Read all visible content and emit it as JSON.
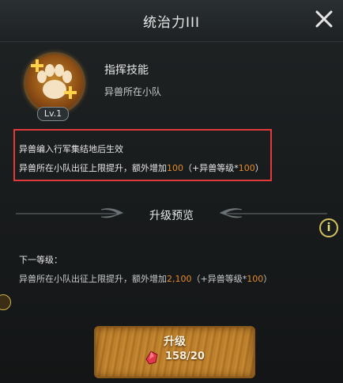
{
  "dialog": {
    "title": "统治力III"
  },
  "skill": {
    "icon": "beast-paw-skill-icon",
    "level": "Lv.1",
    "type": "指挥技能",
    "target": "异兽所在小队"
  },
  "description": {
    "line1": "异兽编入行军集结地后生效",
    "line2_prefix": "异兽所在小队出征上限提升，额外增加",
    "line2_value": "100",
    "line2_mid": "（+异兽等级*",
    "line2_value2": "100",
    "line2_suffix": "）"
  },
  "preview": {
    "title": "升级预览",
    "info_icon": "i",
    "next_label": "下一等级：",
    "next_prefix": "异兽所在小队出征上限提升，额外增加",
    "next_value": "2,100",
    "next_mid": "（+异兽等级*",
    "next_value2": "100",
    "next_suffix": "）"
  },
  "upgrade": {
    "label": "升级",
    "cost": "158/20",
    "cost_icon": "red-crystal-icon"
  },
  "colors": {
    "highlight": "#e08a2a",
    "frame": "#e03a3a",
    "background": "#16191a"
  }
}
